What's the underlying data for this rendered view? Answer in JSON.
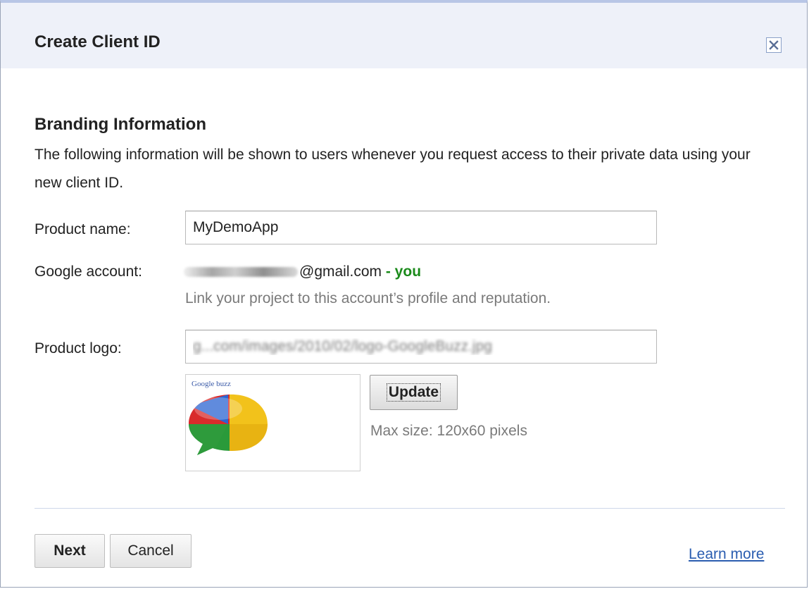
{
  "dialog": {
    "title": "Create Client ID",
    "close_icon": "close-icon"
  },
  "branding": {
    "heading": "Branding Information",
    "description": "The following information will be shown to users whenever you request access to their private data using your new client ID."
  },
  "form": {
    "product_name_label": "Product name:",
    "product_name_value": "MyDemoApp",
    "google_account_label": "Google account:",
    "google_account_email_suffix": "@gmail.com",
    "google_account_you": "- you",
    "google_account_hint": "Link your project to this account’s profile and reputation.",
    "product_logo_label": "Product logo:",
    "product_logo_value": "g...com/images/2010/02/logo-GoogleBuzz.jpg",
    "logo_preview_caption": "Google buzz",
    "update_label": "Update",
    "max_size_text": "Max size: 120x60 pixels"
  },
  "footer": {
    "next_label": "Next",
    "cancel_label": "Cancel",
    "learn_more_label": "Learn more"
  },
  "colors": {
    "titlebar_bg": "#eef1f9",
    "you_green": "#1a8a1a",
    "link_blue": "#2a5db0",
    "hint_gray": "#7a7a7a"
  }
}
